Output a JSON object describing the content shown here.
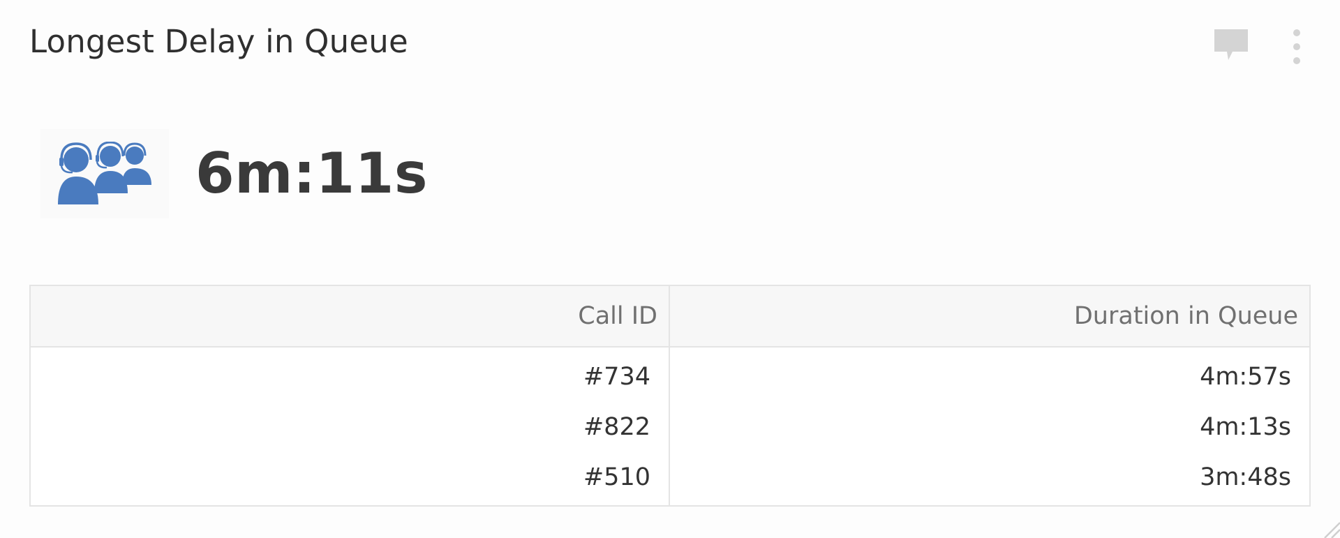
{
  "widget": {
    "title": "Longest Delay in Queue",
    "icons": {
      "comment": "comment-icon",
      "menu": "vertical-ellipsis-icon",
      "kpi": "call-center-agents-icon",
      "resize": "resize-handle-icon"
    },
    "colors": {
      "kpi_icon": "#4a7bbf",
      "toolbar_icon": "#d4d4d4"
    }
  },
  "kpi": {
    "value": "6m:11s"
  },
  "table": {
    "columns": [
      "Call ID",
      "Duration in Queue"
    ],
    "rows": [
      [
        "#734",
        "4m:57s"
      ],
      [
        "#822",
        "4m:13s"
      ],
      [
        "#510",
        "3m:48s"
      ]
    ]
  }
}
